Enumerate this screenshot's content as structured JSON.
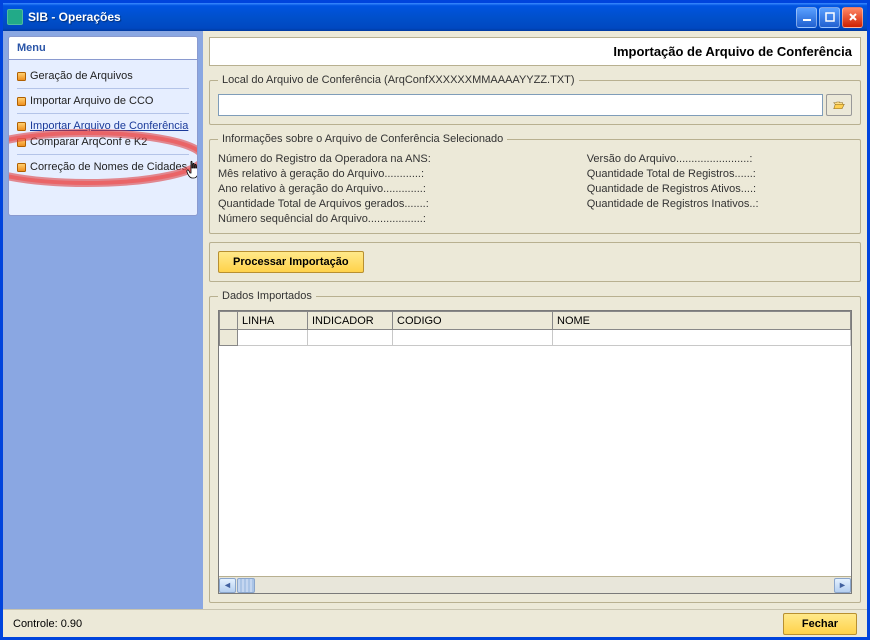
{
  "window": {
    "title": "SIB - Operações"
  },
  "sidebar": {
    "header": "Menu",
    "items": [
      {
        "label": "Geração de Arquivos"
      },
      {
        "label": "Importar Arquivo de CCO"
      },
      {
        "label": "Importar Arquivo de Conferência"
      },
      {
        "label": "Comparar ArqConf e K2"
      },
      {
        "label": "Correção de Nomes de Cidades"
      }
    ]
  },
  "page": {
    "title": "Importação de Arquivo de Conferência",
    "file_group_label": "Local do Arquivo de Conferência (ArqConfXXXXXXMMAAAAYYZZ.TXT)",
    "file_value": "",
    "info_group_label": "Informações sobre o Arquivo de Conferência Selecionado",
    "info_left": [
      "Número do Registro da Operadora na ANS:",
      "Mês relativo à geração do Arquivo............:",
      "Ano relativo à geração do Arquivo.............:",
      "Quantidade Total de Arquivos gerados.......:",
      "Número sequêncial do Arquivo..................:"
    ],
    "info_right": [
      "Versão do Arquivo........................:",
      "Quantidade Total de Registros......:",
      "Quantidade de Registros Ativos....:",
      "Quantidade de Registros Inativos..:"
    ],
    "process_button": "Processar Importação",
    "data_group_label": "Dados Importados",
    "columns": {
      "c1": "LINHA",
      "c2": "INDICADOR",
      "c3": "CODIGO",
      "c4": "NOME"
    }
  },
  "footer": {
    "status": "Controle: 0.90",
    "close": "Fechar"
  }
}
